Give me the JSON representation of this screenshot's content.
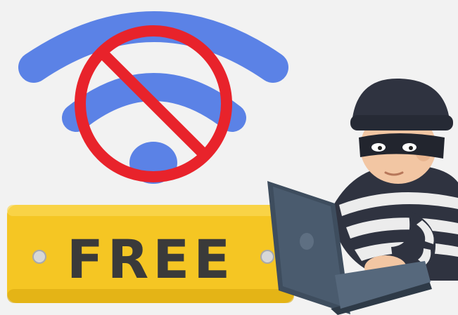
{
  "sign": {
    "label": "FREE"
  },
  "colors": {
    "background": "#f2f2f2",
    "wifi_blue": "#5b82e6",
    "prohibit_red": "#e8232b",
    "sign_yellow": "#f5c623",
    "sign_text": "#3a3a3a",
    "hoodie_dark": "#2f3340",
    "stripe_light": "#ececec",
    "laptop": "#3e4d5e",
    "skin": "#f2c6a3"
  },
  "icons": {
    "wifi": "wifi-icon",
    "prohibit": "prohibited-icon",
    "thief": "hacker-thief-illustration",
    "laptop": "laptop-icon"
  }
}
